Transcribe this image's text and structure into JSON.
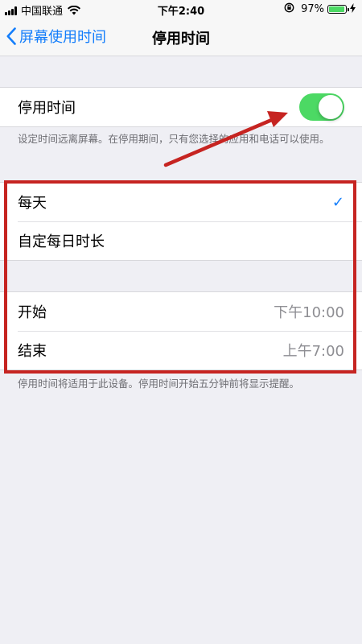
{
  "status_bar": {
    "carrier": "中国联通",
    "time": "下午2:40",
    "battery_percent": "97%",
    "battery_level": 0.97
  },
  "nav": {
    "back_label": "屏幕使用时间",
    "title": "停用时间"
  },
  "toggle_group": {
    "label": "停用时间",
    "enabled": true,
    "description": "设定时间远离屏幕。在停用期间，只有您选择的应用和电话可以使用。"
  },
  "schedule_group": {
    "items": [
      {
        "label": "每天",
        "selected": true
      },
      {
        "label": "自定每日时长",
        "selected": false
      }
    ],
    "check_glyph": "✓"
  },
  "time_group": {
    "start_label": "开始",
    "start_value": "下午10:00",
    "end_label": "结束",
    "end_value": "上午7:00",
    "footnote": "停用时间将适用于此设备。停用时间开始五分钟前将显示提醒。"
  },
  "colors": {
    "accent": "#147efb",
    "toggle_on": "#4cd964",
    "annotation": "#c62421",
    "background": "#efeff4"
  }
}
